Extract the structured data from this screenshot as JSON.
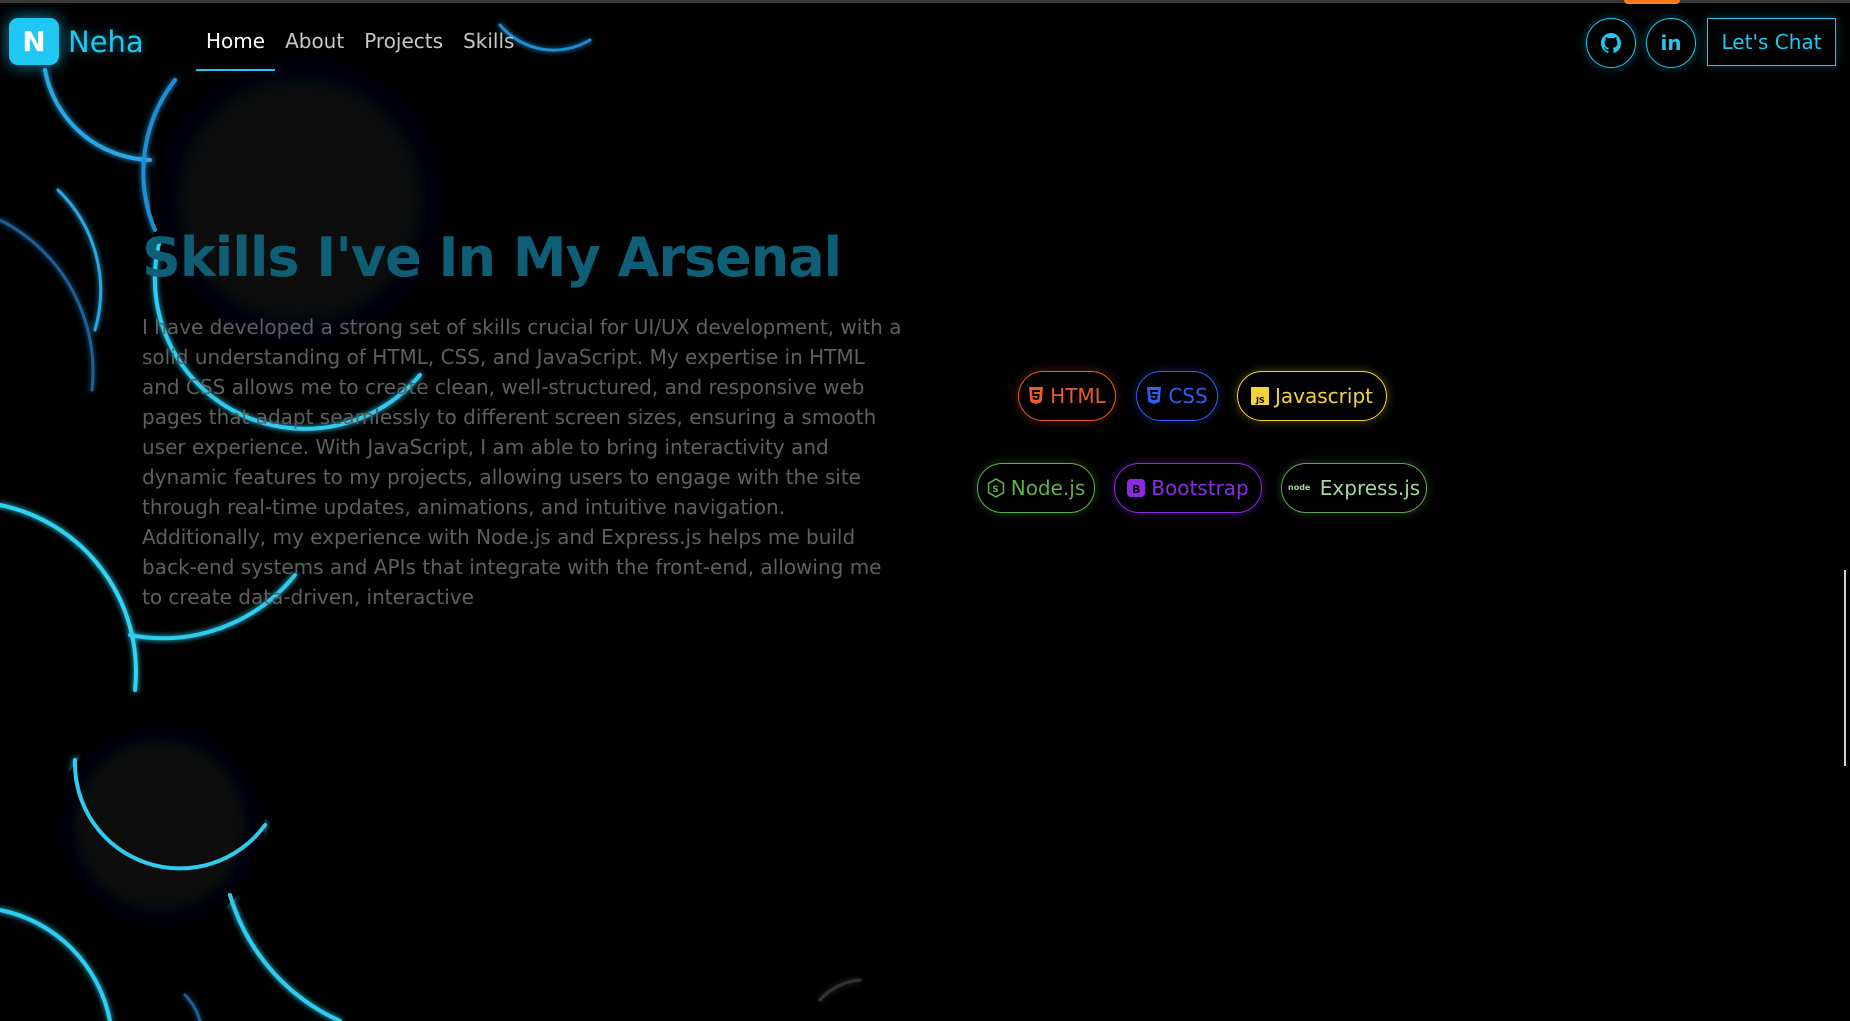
{
  "brand": {
    "initial": "N",
    "name": "Neha"
  },
  "nav": {
    "items": [
      {
        "label": "Home",
        "active": true
      },
      {
        "label": "About",
        "active": false
      },
      {
        "label": "Projects",
        "active": false
      },
      {
        "label": "Skills",
        "active": false
      }
    ]
  },
  "social": {
    "github_icon": "github-icon",
    "linkedin_label": "in"
  },
  "cta": {
    "label": "Let's Chat"
  },
  "hero": {
    "title": "Skills I've In My Arsenal",
    "description": "I have developed a strong set of skills crucial for UI/UX development, with a solid understanding of HTML, CSS, and JavaScript. My expertise in HTML and CSS allows me to create clean, well-structured, and responsive web pages that adapt seamlessly to different screen sizes, ensuring a smooth user experience. With JavaScript, I am able to bring interactivity and dynamic features to my projects, allowing users to engage with the site through real-time updates, animations, and intuitive navigation. Additionally, my experience with Node.js and Express.js helps me build back-end systems and APIs that integrate with the front-end, allowing me to create data-driven, interactive"
  },
  "skills": [
    {
      "label": "HTML",
      "icon": "html5-icon",
      "color": "#ea5a2d"
    },
    {
      "label": "CSS",
      "icon": "css3-icon",
      "color": "#2f5ff0"
    },
    {
      "label": "Javascript",
      "icon": "js-icon",
      "color": "#f2d43a"
    },
    {
      "label": "Node.js",
      "icon": "nodejs-icon",
      "color": "#5fb046"
    },
    {
      "label": "Bootstrap",
      "icon": "bootstrap-icon",
      "color": "#8a2be2"
    },
    {
      "label": "Express.js",
      "icon": "node-logo-icon",
      "color": "#a6d7a0"
    }
  ],
  "colors": {
    "accent": "#1ec8f2",
    "title": "#0e5e75",
    "background": "#000000"
  }
}
